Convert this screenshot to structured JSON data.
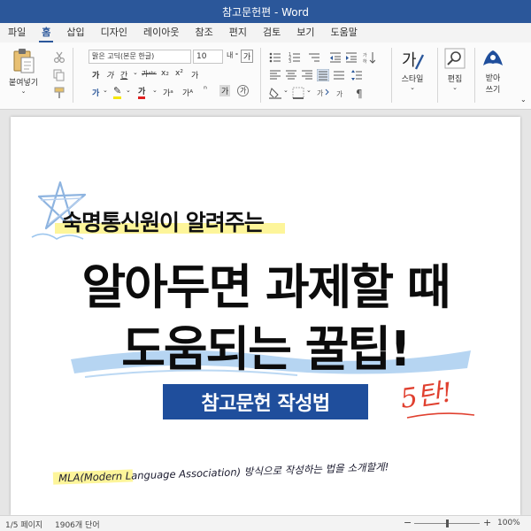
{
  "window": {
    "title": "참고문헌편 - Word"
  },
  "menu": {
    "tabs": [
      "파일",
      "홈",
      "삽입",
      "디자인",
      "레이아웃",
      "참조",
      "편지",
      "검토",
      "보기",
      "도움말"
    ],
    "active_tab": "홈"
  },
  "ribbon": {
    "paste_label": "붙여넣기",
    "font_name": "맑은 고딕(본문 한글)",
    "font_size": "10",
    "styles_label": "스타일",
    "editing_label": "편집",
    "dictate_label_1": "받아",
    "dictate_label_2": "쓰기"
  },
  "document": {
    "subheadline": "숙명통신원이 알려주는",
    "headline_1": "알아두면 과제할 때",
    "headline_2": "도움되는 꿀팁!",
    "badge": "참고문헌 작성법",
    "tan": "5탄!",
    "footer": "MLA(Modern Language Association) 방식으로 작성하는 법을 소개할게!"
  },
  "status": {
    "page": "1/5 페이지",
    "words": "1906개 단어",
    "zoom": "100%"
  },
  "colors": {
    "word_blue": "#2b579a",
    "badge_blue": "#1f4e9c",
    "accent_red": "#e0402f",
    "highlight_blue": "#9ec7ee",
    "highlight_yellow": "#fdf59a"
  }
}
